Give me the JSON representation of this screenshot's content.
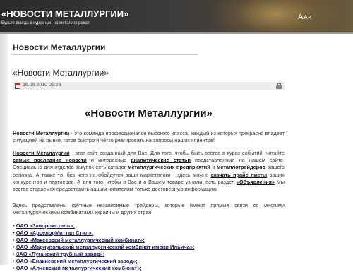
{
  "header": {
    "site_title": "«НОВОСТИ МЕТАЛЛУРГИИ»",
    "slogan": "Будьте всегда в курсе цен на металлопрокат",
    "font_size": {
      "large": "A",
      "medium": "A",
      "small": "K"
    }
  },
  "page": {
    "heading": "Новости Металлургии",
    "article_title": "«Новости Металлургии»",
    "date": "16.05.2010 01:28"
  },
  "article": {
    "heading": "«Новости Металлургии»",
    "p1": {
      "link": "Новости Металлургии",
      "text": " - это команда профессионалов высокого класса, каждый из которых прекрасно владеет ситуацией на рынке, готов быстро и чётко реагировать на запросы наших клиентов!"
    },
    "p2": {
      "link1": "Новости Металлургии",
      "t1": " - этот сайт созданный для Вас. Для того, чтобы быть всегда в курсе событий, читайте ",
      "link2": "самые последние новости",
      "t2": " и интересные ",
      "link3": "аналитические статьи",
      "t3": " представленные на нашем сайте. Специально для отделов закупок есть каталог ",
      "link4": "металлургических предприятий",
      "t4": " и ",
      "link5": "металлотрейдеров",
      "t5": " вашего региона. А также то, без чего не обойдутся ваши маркетологи - здесь можно ",
      "link6": "скачать прайс листы",
      "t6": " ваших конкурентов и партнеров.  А для того, чтобы о Вас и о Вашем товаре узнали, есть раздел ",
      "link7": "«Объявления»",
      "t7": " Мы всегда стараемся предоставить нашим читателям только достоверную информацию."
    },
    "p3": "Здесь представлены крупные независимые трейдеры, которые имеют прямые связи со многими металлургическими комбинатами Украины и других стран:",
    "companies": [
      "ОАО «Запорожсталь»;",
      "ОАО «АрселорМиттал Стил»;",
      "ОАО «Макеевский металлургический комбинат»;",
      "ОАО «Мариупольский металлургический комбинат имени Ильича»;",
      "ЗАО «Луганский трубный завод»;",
      "ОАО «Енакиевский металлургический завод»;",
      "ОАО «Алчевский металлургический комбинат»;"
    ]
  },
  "colors": {
    "header_bg": "#333333",
    "accent_glow": "#d2aa5a",
    "link": "#1a1a6a"
  }
}
